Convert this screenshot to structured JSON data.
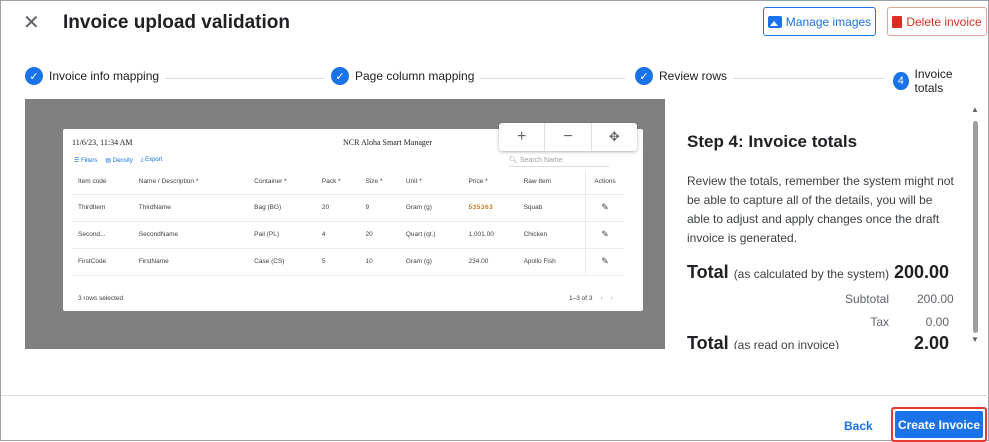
{
  "header": {
    "title": "Invoice upload validation",
    "close_icon": "close-icon",
    "manage_images_label": "Manage images",
    "delete_invoice_label": "Delete invoice"
  },
  "stepper": {
    "steps": [
      {
        "label": "Invoice info mapping",
        "state": "done"
      },
      {
        "label": "Page column mapping",
        "state": "done"
      },
      {
        "label": "Review rows",
        "state": "done"
      },
      {
        "label": "Invoice totals",
        "state": "current",
        "number": "4"
      }
    ]
  },
  "preview": {
    "timestamp": "11/6/23, 11:34 AM",
    "app_name": "NCR Aloha Smart Manager",
    "toolbar": {
      "filters": "Filters",
      "density": "Density",
      "export": "Export"
    },
    "search_placeholder": "Search Name",
    "zoom": {
      "in": "+",
      "out": "−"
    },
    "columns": [
      "Item code",
      "Name / Description *",
      "Container *",
      "Pack *",
      "Size *",
      "Unit *",
      "Price *",
      "Raw Item",
      "Actions"
    ],
    "rows": [
      [
        "ThirdItem",
        "ThirdName",
        "Bag (BG)",
        "20",
        "9",
        "Gram (g)",
        "535363",
        "Squab"
      ],
      [
        "Second...",
        "SecondName",
        "Pail (PL)",
        "4",
        "20",
        "Quart (qt.)",
        "1,001.00",
        "Chicken"
      ],
      [
        "FirstCode",
        "FirstName",
        "Case (CS)",
        "5",
        "10",
        "Gram (g)",
        "234.00",
        "Apollo Fish"
      ]
    ],
    "footer_selected": "3 rows selected",
    "pager": "1–3 of 3"
  },
  "panel": {
    "title": "Step 4: Invoice totals",
    "description": "Review the totals, remember the system might not be able to capture all of the details, you will be able to adjust and apply changes once the draft invoice is generated.",
    "total_label": "Total",
    "total_note": "(as calculated by the system)",
    "total_value": "200.00",
    "subtotal_label": "Subtotal",
    "subtotal_value": "200.00",
    "tax_label": "Tax",
    "tax_value": "0.00",
    "total2_label": "Total",
    "total2_note": "(as read on invoice)",
    "total2_value": "2.00"
  },
  "footer": {
    "back_label": "Back",
    "create_label": "Create Invoice"
  },
  "colors": {
    "accent": "#1a73e8",
    "danger": "#d93025",
    "highlight": "#e53935"
  }
}
